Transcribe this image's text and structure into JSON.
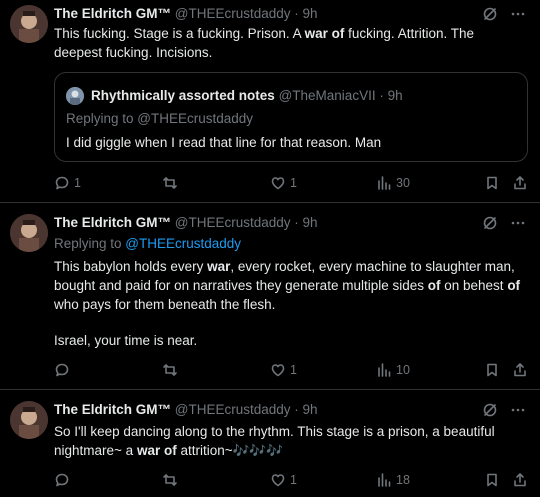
{
  "tweets": [
    {
      "name": "The Eldritch GM™",
      "handle": "@THEEcrustdaddy",
      "time": "· 9h",
      "text_parts": [
        "This fucking. Stage is a fucking. Prison. A ",
        "war of",
        " fucking. Attrition. The deepest fucking. Incisions."
      ],
      "quote": {
        "name": "Rhythmically assorted notes",
        "handle": "@TheManiacVII",
        "time": "· 9h",
        "replying": "Replying to @THEEcrustdaddy",
        "text": "I did giggle when I read that line for that reason. Man"
      },
      "actions": {
        "replies": "1",
        "retweets": "",
        "likes": "1",
        "views": "30"
      }
    },
    {
      "name": "The Eldritch GM™",
      "handle": "@THEEcrustdaddy",
      "time": "· 9h",
      "replying_prefix": "Replying to ",
      "replying_handle": "@THEEcrustdaddy",
      "text_parts": [
        "This babylon holds every ",
        "war",
        ", every rocket, every machine to slaughter man, bought and paid for on narratives they generate multiple sides ",
        "of",
        " on behest ",
        "of",
        " who pays for them beneath the flesh."
      ],
      "text2": "Israel, your time is near.",
      "actions": {
        "replies": "",
        "retweets": "",
        "likes": "1",
        "views": "10"
      }
    },
    {
      "name": "The Eldritch GM™",
      "handle": "@THEEcrustdaddy",
      "time": "· 9h",
      "text_parts": [
        "So I'll keep dancing along to the rhythm. This stage is a prison, a beautiful nightmare~ a ",
        "war of",
        " attrition~",
        "🎶🎶🎶"
      ],
      "actions": {
        "replies": "",
        "retweets": "",
        "likes": "1",
        "views": "18"
      }
    }
  ],
  "icons": [
    "grok-icon",
    "more-icon",
    "reply-icon",
    "retweet-icon",
    "like-icon",
    "views-icon",
    "bookmark-icon",
    "share-icon"
  ],
  "colors": {
    "background": "#000000",
    "text": "#e7e9ea",
    "muted": "#71767b",
    "link": "#1d9bf0",
    "divider": "#2f3336"
  }
}
